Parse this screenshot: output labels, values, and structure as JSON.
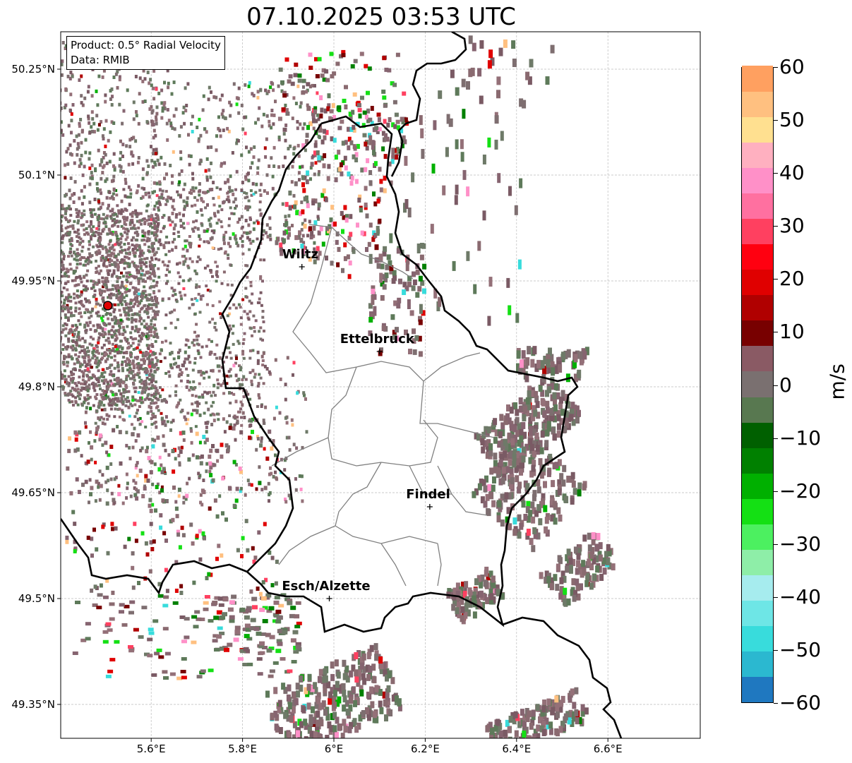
{
  "title": "07.10.2025 03:53 UTC",
  "info": {
    "product": "Product: 0.5° Radial Velocity",
    "source": "Data: RMIB"
  },
  "lat_ticks": [
    "50.25°N",
    "50.1°N",
    "49.95°N",
    "49.8°N",
    "49.65°N",
    "49.5°N",
    "49.35°N"
  ],
  "lon_ticks": [
    "5.6°E",
    "5.8°E",
    "6°E",
    "6.2°E",
    "6.4°E",
    "6.6°E"
  ],
  "cities": [
    {
      "name": "Wiltz",
      "lon": 5.93,
      "lat": 49.97
    },
    {
      "name": "Ettelbruck",
      "lon": 6.1,
      "lat": 49.85
    },
    {
      "name": "Findel",
      "lon": 6.21,
      "lat": 49.63
    },
    {
      "name": "Esch/Alzette",
      "lon": 5.99,
      "lat": 49.5
    }
  ],
  "radar_site": {
    "lon": 5.505,
    "lat": 49.915
  },
  "colorbar": {
    "label": "m/s",
    "min": -60,
    "max": 60,
    "ticks": [
      "60",
      "50",
      "40",
      "30",
      "20",
      "10",
      "0",
      "−10",
      "−20",
      "−30",
      "−40",
      "−50",
      "−60"
    ],
    "stops": [
      "#1f78c0",
      "#2bb8d0",
      "#38dcdc",
      "#6ee6e6",
      "#a6ecee",
      "#8eeea8",
      "#4cf060",
      "#14e014",
      "#00b000",
      "#008000",
      "#006000",
      "#587850",
      "#7a7070",
      "#8a5a64",
      "#780000",
      "#b00000",
      "#e00000",
      "#ff0010",
      "#ff4060",
      "#ff70a0",
      "#ff90c8",
      "#ffb0c0",
      "#ffe090",
      "#ffc080",
      "#ffa060"
    ]
  },
  "chart_data": {
    "type": "map",
    "extent": {
      "lon_min": 5.4,
      "lon_max": 6.8,
      "lat_min": 49.3,
      "lat_max": 50.3
    },
    "product": "0.5° Radial Velocity",
    "units": "m/s",
    "value_range": [
      -60,
      60
    ]
  }
}
